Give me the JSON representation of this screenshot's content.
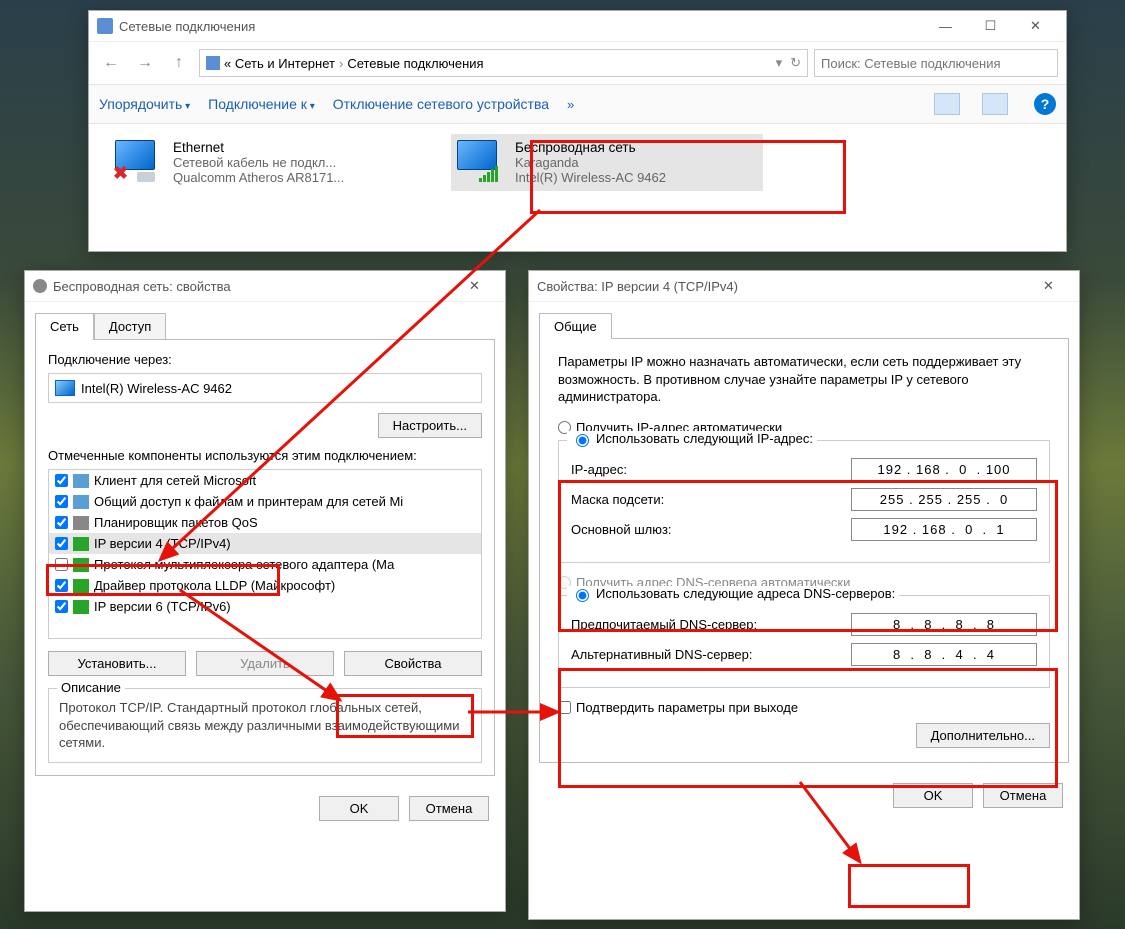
{
  "explorer": {
    "title": "Сетевые подключения",
    "breadcrumb": {
      "pre": "« Сеть и Интернет",
      "current": "Сетевые подключения"
    },
    "search_placeholder": "Поиск: Сетевые подключения",
    "menu": {
      "organize": "Упорядочить",
      "connect": "Подключение к",
      "disable": "Отключение сетевого устройства",
      "more": "»"
    },
    "conn1": {
      "name": "Ethernet",
      "line2": "Сетевой кабель не подкл...",
      "line3": "Qualcomm Atheros AR8171..."
    },
    "conn2": {
      "name": "Беспроводная сеть",
      "line2": "Karaganda",
      "line3": "Intel(R) Wireless-AC 9462"
    }
  },
  "props1": {
    "title": "Беспроводная сеть: свойства",
    "tab1": "Сеть",
    "tab2": "Доступ",
    "connect_via": "Подключение через:",
    "adapter": "Intel(R) Wireless-AC 9462",
    "configure": "Настроить...",
    "components_label": "Отмеченные компоненты используются этим подключением:",
    "components": [
      {
        "label": "Клиент для сетей Microsoft",
        "checked": true,
        "cls": "ci"
      },
      {
        "label": "Общий доступ к файлам и принтерам для сетей Mi",
        "checked": true,
        "cls": "ci"
      },
      {
        "label": "Планировщик пакетов QoS",
        "checked": true,
        "cls": "ci net"
      },
      {
        "label": "IP версии 4 (TCP/IPv4)",
        "checked": true,
        "cls": "ci green",
        "sel": true
      },
      {
        "label": "Протокол мультиплексора сетевого адаптера (Ма",
        "checked": false,
        "cls": "ci green"
      },
      {
        "label": "Драйвер протокола LLDP (Майкрософт)",
        "checked": true,
        "cls": "ci green"
      },
      {
        "label": "IP версии 6 (TCP/IPv6)",
        "checked": true,
        "cls": "ci green"
      }
    ],
    "install": "Установить...",
    "remove": "Удалить",
    "properties": "Свойства",
    "desc_title": "Описание",
    "desc_text": "Протокол TCP/IP. Стандартный протокол глобальных сетей, обеспечивающий связь между различными взаимодействующими сетями.",
    "ok": "OK",
    "cancel": "Отмена"
  },
  "props2": {
    "title": "Свойства: IP версии 4 (TCP/IPv4)",
    "tab": "Общие",
    "info": "Параметры IP можно назначать автоматически, если сеть поддерживает эту возможность. В противном случае узнайте параметры IP у сетевого администратора.",
    "r1": "Получить IP-адрес автоматически",
    "r2": "Использовать следующий IP-адрес:",
    "ip_label": "IP-адрес:",
    "ip_value": "192 . 168 .  0  . 100",
    "mask_label": "Маска подсети:",
    "mask_value": "255 . 255 . 255 .  0",
    "gw_label": "Основной шлюз:",
    "gw_value": "192 . 168 .  0  .  1",
    "r3": "Получить адрес DNS-сервера автоматически",
    "r4": "Использовать следующие адреса DNS-серверов:",
    "dns1_label": "Предпочитаемый DNS-сервер:",
    "dns1_value": "8  .  8  .  8  .  8",
    "dns2_label": "Альтернативный DNS-сервер:",
    "dns2_value": "8  .  8  .  4  .  4",
    "validate": "Подтвердить параметры при выходе",
    "advanced": "Дополнительно...",
    "ok": "OK",
    "cancel": "Отмена"
  }
}
